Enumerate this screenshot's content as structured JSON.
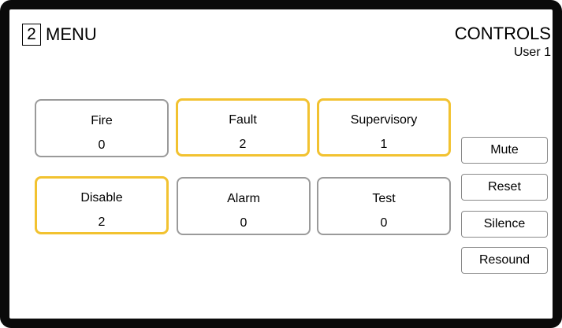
{
  "header": {
    "menu_number": "2",
    "menu_label": "MENU",
    "title": "CONTROLS",
    "user": "User 1"
  },
  "tiles": [
    {
      "label": "Fire",
      "count": "0",
      "highlighted": false
    },
    {
      "label": "Fault",
      "count": "2",
      "highlighted": true
    },
    {
      "label": "Supervisory",
      "count": "1",
      "highlighted": true
    },
    {
      "label": "Disable",
      "count": "2",
      "highlighted": true
    },
    {
      "label": "Alarm",
      "count": "0",
      "highlighted": false
    },
    {
      "label": "Test",
      "count": "0",
      "highlighted": false
    }
  ],
  "buttons": {
    "mute": "Mute",
    "reset": "Reset",
    "silence": "Silence",
    "resound": "Resound"
  },
  "colors": {
    "highlight": "#f2c230",
    "border": "#9a9a9a",
    "frame": "#0a0a0a"
  }
}
